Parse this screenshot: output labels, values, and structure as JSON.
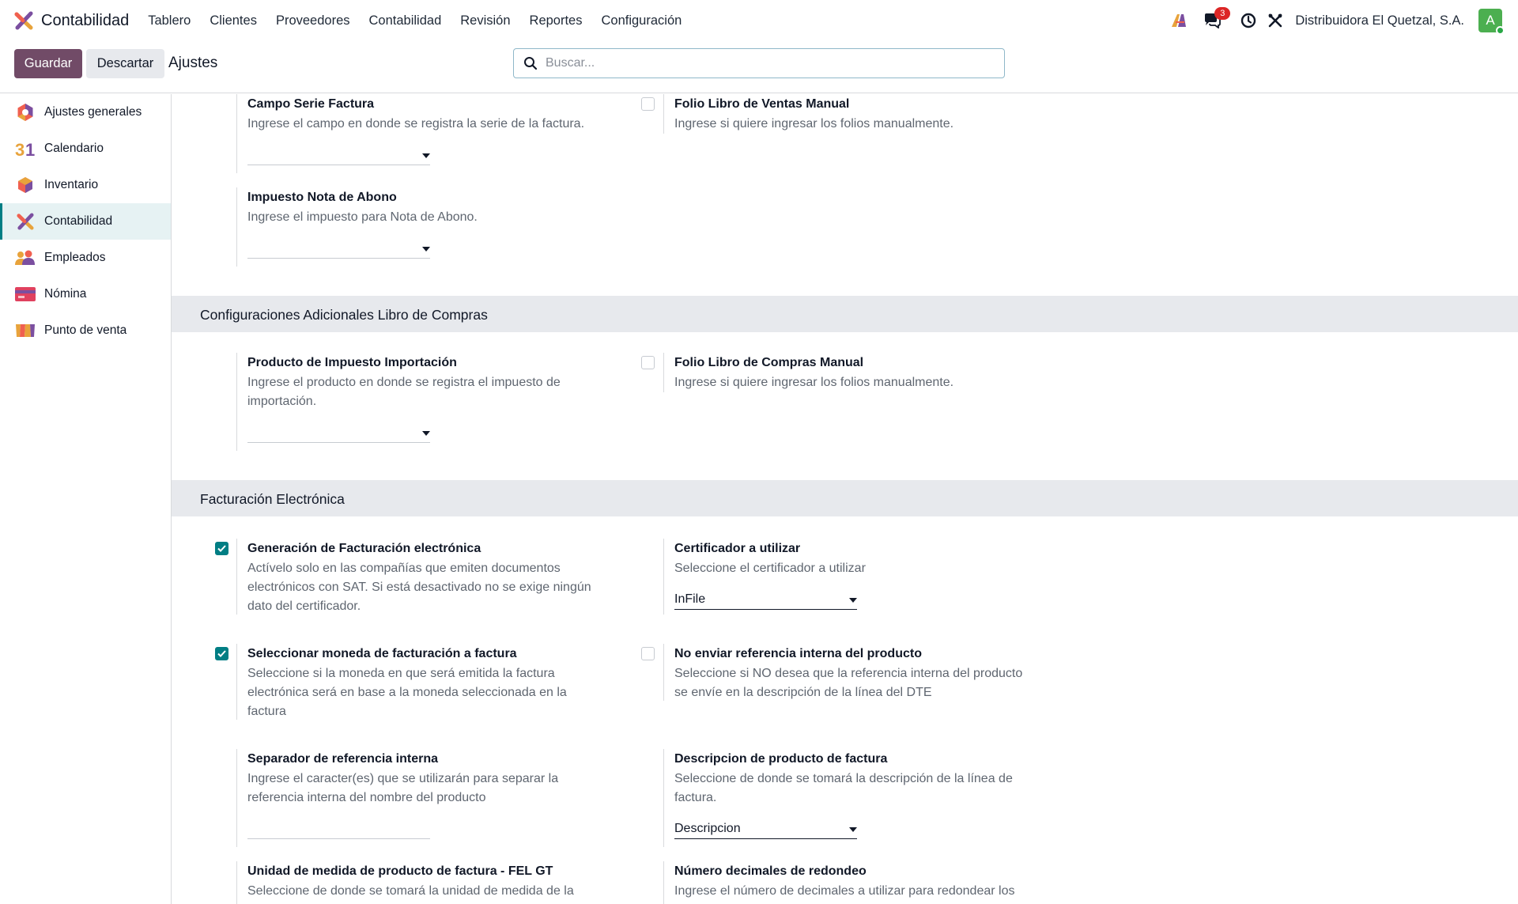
{
  "app": {
    "name": "Contabilidad",
    "menu": [
      "Tablero",
      "Clientes",
      "Proveedores",
      "Contabilidad",
      "Revisión",
      "Reportes",
      "Configuración"
    ],
    "notifications": "3",
    "company": "Distribuidora El Quetzal, S.A.",
    "avatar_letter": "A"
  },
  "control": {
    "save": "Guardar",
    "discard": "Descartar",
    "title": "Ajustes",
    "search_placeholder": "Buscar..."
  },
  "sidebar": {
    "items": [
      {
        "label": "Ajustes generales",
        "icon": "general-settings-icon"
      },
      {
        "label": "Calendario",
        "icon": "calendar-icon"
      },
      {
        "label": "Inventario",
        "icon": "inventory-icon"
      },
      {
        "label": "Contabilidad",
        "icon": "accounting-icon",
        "active": true
      },
      {
        "label": "Empleados",
        "icon": "employees-icon"
      },
      {
        "label": "Nómina",
        "icon": "payroll-icon"
      },
      {
        "label": "Punto de venta",
        "icon": "point-of-sale-icon"
      }
    ]
  },
  "settings": {
    "serie": {
      "title": "Campo Serie Factura",
      "desc": "Ingrese el campo en donde se registra la serie de la factura.",
      "value": ""
    },
    "folio_ventas": {
      "title": "Folio Libro de Ventas Manual",
      "desc": "Ingrese si quiere ingresar los folios manualmente.",
      "checked": false
    },
    "nota_abono": {
      "title": "Impuesto Nota de Abono",
      "desc": "Ingrese el impuesto para Nota de Abono.",
      "value": ""
    },
    "compras_header": "Configuraciones Adicionales Libro de Compras",
    "importacion": {
      "title": "Producto de Impuesto Importación",
      "desc_1": "Ingrese el producto en donde se registra el impuesto de",
      "desc_2": "importación.",
      "value": ""
    },
    "folio_compras": {
      "title": "Folio Libro de Compras Manual",
      "desc": "Ingrese si quiere ingresar los folios manualmente.",
      "checked": false
    },
    "fel_header": "Facturación Electrónica",
    "generacion": {
      "title": "Generación de Facturación electrónica",
      "desc_1": "Actívelo solo en las compañías que emiten documentos",
      "desc_2": "electrónicos con SAT. Si está desactivado no se exige ningún",
      "desc_3": "dato del certificador.",
      "checked": true
    },
    "certificador": {
      "title": "Certificador a utilizar",
      "desc": "Seleccione el certificador a utilizar",
      "value": "InFile"
    },
    "moneda": {
      "title": "Seleccionar moneda de facturación a factura",
      "desc_1": "Seleccione si la moneda en que será emitida la factura",
      "desc_2": "electrónica será en base a la moneda seleccionada en la",
      "desc_3": "factura",
      "checked": true
    },
    "referencia": {
      "title": "No enviar referencia interna del producto",
      "desc_1": "Seleccione si NO desea que la referencia interna del producto",
      "desc_2": "se envíe en la descripción de la línea del DTE",
      "checked": false
    },
    "separador": {
      "title": "Separador de referencia interna",
      "desc_1": "Ingrese el caracter(es) que se utilizarán para separar la",
      "desc_2": "referencia interna del nombre del producto",
      "value": ""
    },
    "descripcion": {
      "title": "Descripcion de producto de factura",
      "desc_1": "Seleccione de donde se tomará la descripción de la línea de",
      "desc_2": "factura.",
      "value": "Descripcion"
    },
    "unidad": {
      "title": "Unidad de medida de producto de factura - FEL GT",
      "desc_1": "Seleccione de donde se tomará la unidad de medida de la"
    },
    "decimales": {
      "title": "Número decimales de redondeo",
      "desc_1": "Ingrese el número de decimales a utilizar para redondear los"
    }
  }
}
